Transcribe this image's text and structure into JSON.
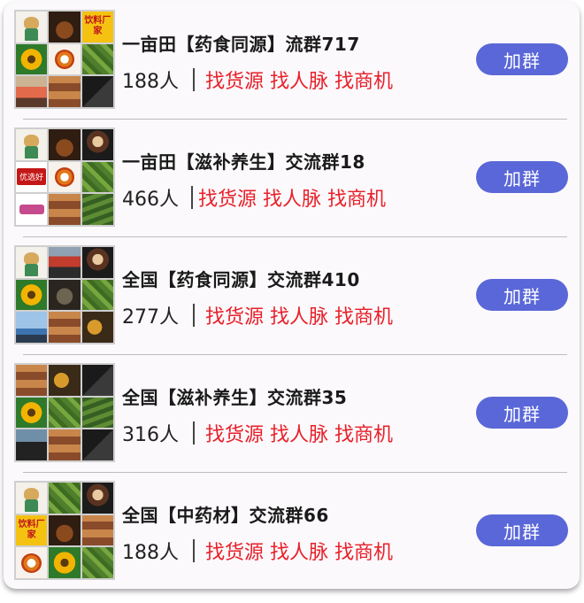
{
  "groups": [
    {
      "title": "一亩田【药食同源】流群717",
      "count": "188人",
      "tags": "找货源 找人脉 找商机",
      "join_label": "加群",
      "yellow_text": "饮料厂家"
    },
    {
      "title": "一亩田【滋补养生】交流群18",
      "count": "466人",
      "tags": "找货源 找人脉 找商机",
      "join_label": "加群",
      "badge_text": "优选好"
    },
    {
      "title": "全国【药食同源】交流群410",
      "count": "277人",
      "tags": "找货源 找人脉 找商机",
      "join_label": "加群"
    },
    {
      "title": "全国【滋补养生】交流群35",
      "count": "316人",
      "tags": "找货源 找人脉 找商机",
      "join_label": "加群"
    },
    {
      "title": "全国【中药材】交流群66",
      "count": "188人",
      "tags": "找货源 找人脉 找商机",
      "join_label": "加群",
      "yellow_text": "饮料厂家"
    }
  ],
  "colors": {
    "accent_button": "#5a67d8",
    "tag_red": "#e8202a",
    "card_bg": "#fbf9fb"
  }
}
